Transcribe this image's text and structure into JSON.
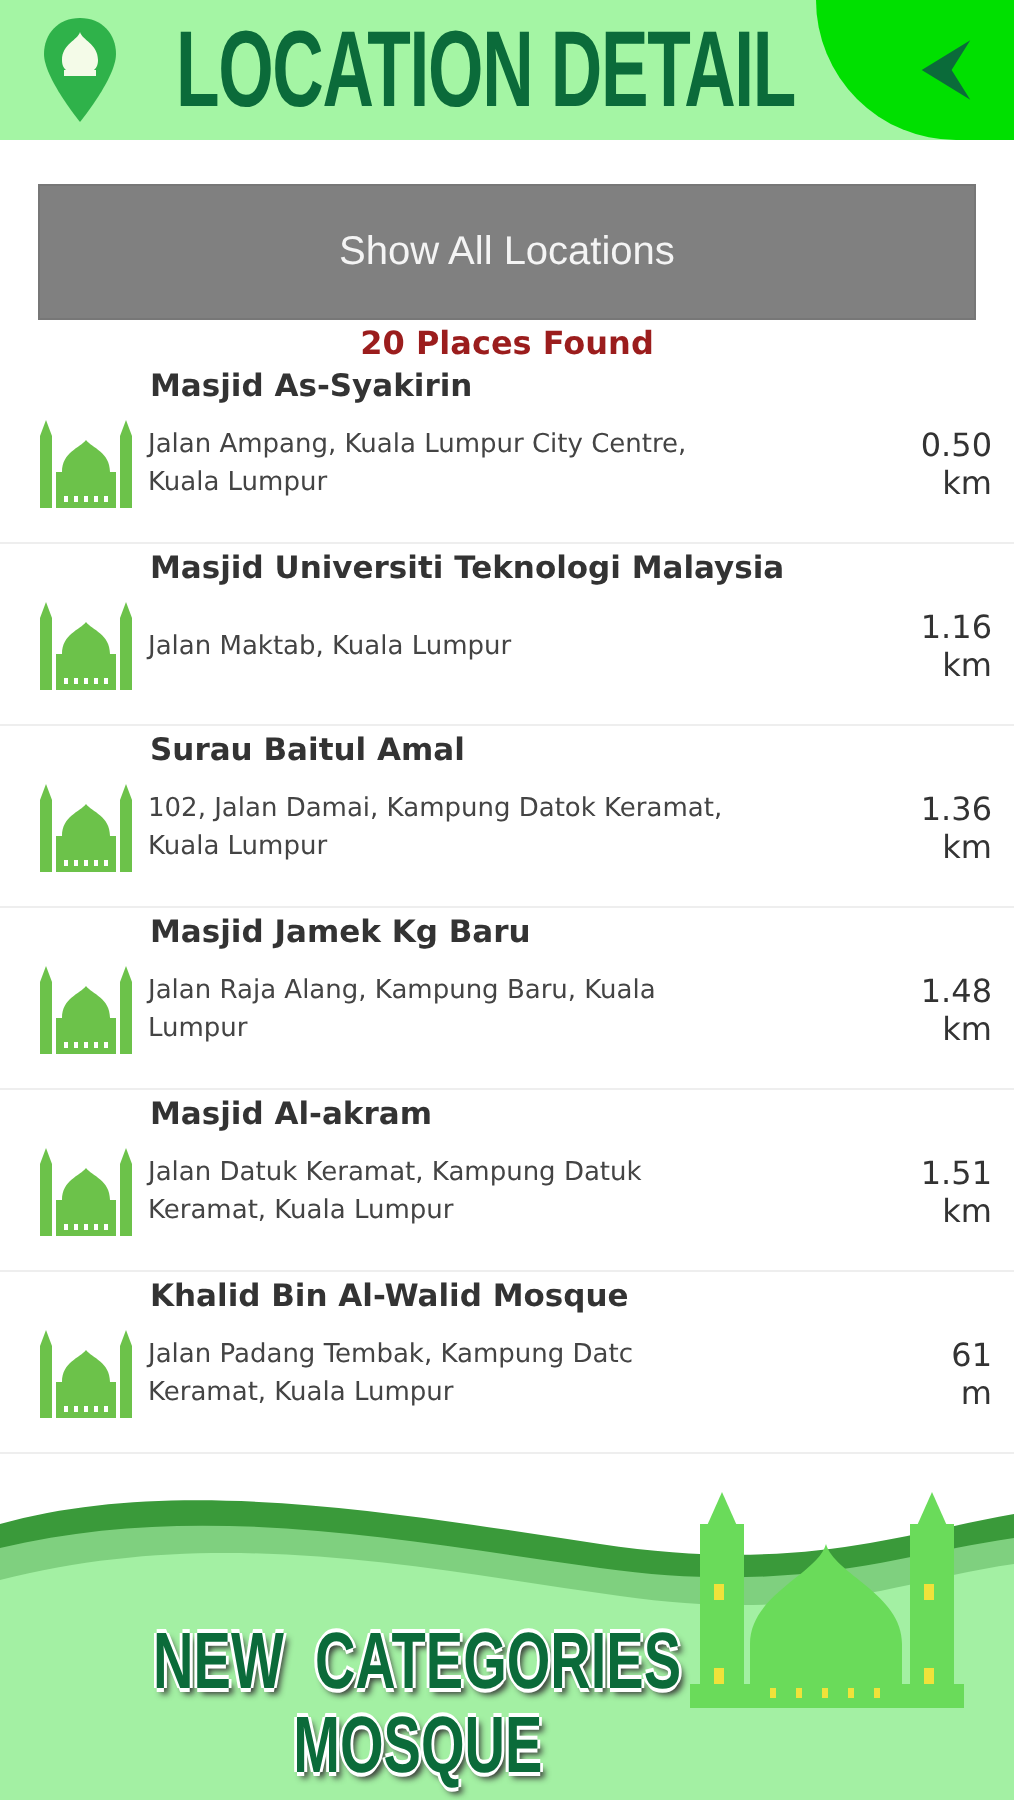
{
  "header": {
    "title": "LOCATION DETAIL"
  },
  "show_all_button": {
    "label": "Show All Locations"
  },
  "results_count": "20 Places Found",
  "places": [
    {
      "name": "Masjid As-Syakirin",
      "address_lines": [
        "Jalan Ampang, Kuala Lumpur City Centre,",
        "Kuala Lumpur"
      ],
      "distance_lines": [
        "0.50",
        "km"
      ]
    },
    {
      "name": "Masjid Universiti Teknologi Malaysia",
      "address_lines": [
        "Jalan Maktab, Kuala Lumpur"
      ],
      "distance_lines": [
        "1.16",
        "km"
      ]
    },
    {
      "name": "Surau Baitul Amal",
      "address_lines": [
        "102, Jalan Damai, Kampung Datok Keramat,",
        "Kuala Lumpur"
      ],
      "distance_lines": [
        "1.36",
        "km"
      ]
    },
    {
      "name": "Masjid Jamek Kg Baru",
      "address_lines": [
        "Jalan Raja Alang, Kampung Baru, Kuala",
        "Lumpur"
      ],
      "distance_lines": [
        "1.48",
        "km"
      ]
    },
    {
      "name": "Masjid Al-akram",
      "address_lines": [
        "Jalan Datuk Keramat, Kampung Datuk",
        "Keramat, Kuala Lumpur"
      ],
      "distance_lines": [
        "1.51",
        "km"
      ]
    },
    {
      "name": "Khalid Bin Al-Walid Mosque",
      "address_lines": [
        "Jalan Padang Tembak, Kampung Datc",
        "Keramat, Kuala Lumpur"
      ],
      "distance_lines": [
        "61",
        "m"
      ]
    }
  ],
  "promo_banner": {
    "lines": [
      "NEW  CATEGORIES",
      "MOSQUE"
    ]
  }
}
